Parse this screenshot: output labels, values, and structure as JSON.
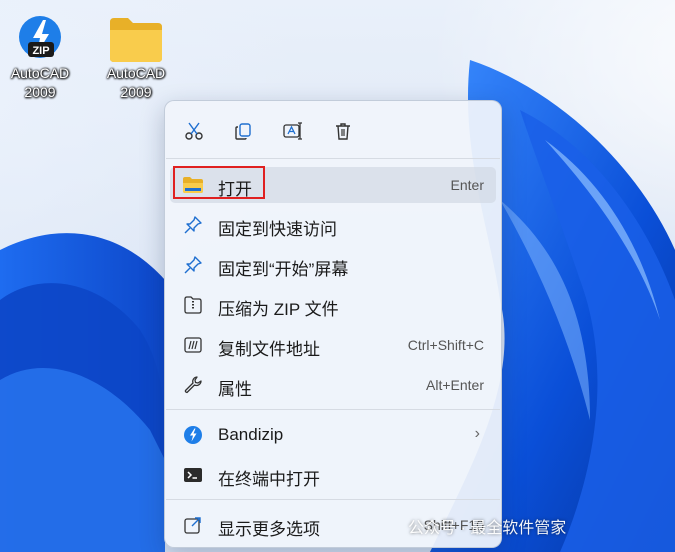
{
  "desktop": {
    "icons": [
      {
        "label": "AutoCAD\n2009",
        "type": "zip-archive"
      },
      {
        "label": "AutoCAD\n2009",
        "type": "folder"
      }
    ],
    "zip_badge": "ZIP"
  },
  "context_menu": {
    "toolbar": [
      {
        "name": "cut",
        "icon": "scissors-icon"
      },
      {
        "name": "copy",
        "icon": "copy-icon"
      },
      {
        "name": "rename",
        "icon": "rename-icon"
      },
      {
        "name": "delete",
        "icon": "trash-icon"
      }
    ],
    "items": [
      {
        "label": "打开",
        "shortcut": "Enter",
        "icon": "folder-icon",
        "highlighted": true
      },
      {
        "label": "固定到快速访问",
        "shortcut": "",
        "icon": "pin-icon"
      },
      {
        "label": "固定到“开始”屏幕",
        "shortcut": "",
        "icon": "pin-icon"
      },
      {
        "label": "压缩为 ZIP 文件",
        "shortcut": "",
        "icon": "zip-file-icon"
      },
      {
        "label": "复制文件地址",
        "shortcut": "Ctrl+Shift+C",
        "icon": "path-icon"
      },
      {
        "label": "属性",
        "shortcut": "Alt+Enter",
        "icon": "wrench-icon"
      },
      {
        "label": "Bandizip",
        "shortcut": "",
        "icon": "bandizip-icon",
        "submenu": true
      },
      {
        "label": "在终端中打开",
        "shortcut": "",
        "icon": "terminal-icon"
      },
      {
        "label": "显示更多选项",
        "shortcut": "Shift+F10",
        "icon": "more-options-icon"
      }
    ]
  },
  "watermark": "公众号 · 最全软件管家",
  "colors": {
    "accent": "#2a6fd6",
    "highlight_box": "#e02020"
  }
}
